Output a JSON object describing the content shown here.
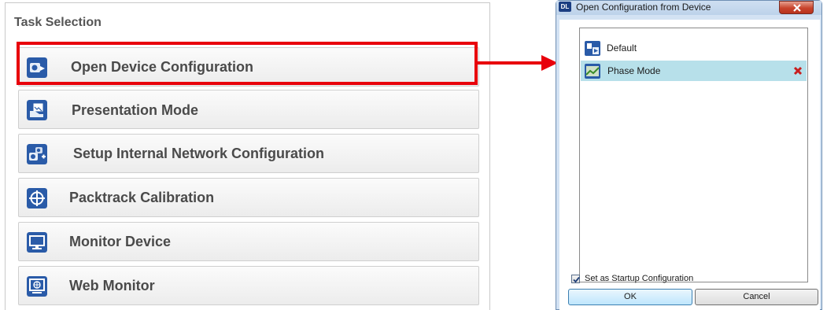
{
  "task_panel": {
    "title": "Task Selection",
    "buttons": [
      {
        "label": "Open Device Configuration",
        "icon": "open-config-icon"
      },
      {
        "label": "Presentation Mode",
        "icon": "presentation-icon"
      },
      {
        "label": "Setup Internal Network Configuration",
        "icon": "network-config-icon"
      },
      {
        "label": "Packtrack Calibration",
        "icon": "crosshair-icon"
      },
      {
        "label": "Monitor Device",
        "icon": "monitor-icon"
      },
      {
        "label": "Web Monitor",
        "icon": "web-monitor-icon"
      }
    ],
    "highlighted": "Open Device Configuration"
  },
  "dialog": {
    "app_icon_text": "DL",
    "title": "Open Configuration from Device",
    "items": [
      {
        "label": "Default",
        "icon": "config-file-icon",
        "selected": false
      },
      {
        "label": "Phase Mode",
        "icon": "phase-mode-icon",
        "selected": true
      }
    ],
    "startup_checkbox": {
      "label": "Set as Startup Configuration",
      "checked": true
    },
    "ok_label": "OK",
    "cancel_label": "Cancel"
  },
  "colors": {
    "highlight": "#e8000b",
    "selected_row": "#b7e0ea",
    "icon_blue": "#2a5ba8"
  }
}
